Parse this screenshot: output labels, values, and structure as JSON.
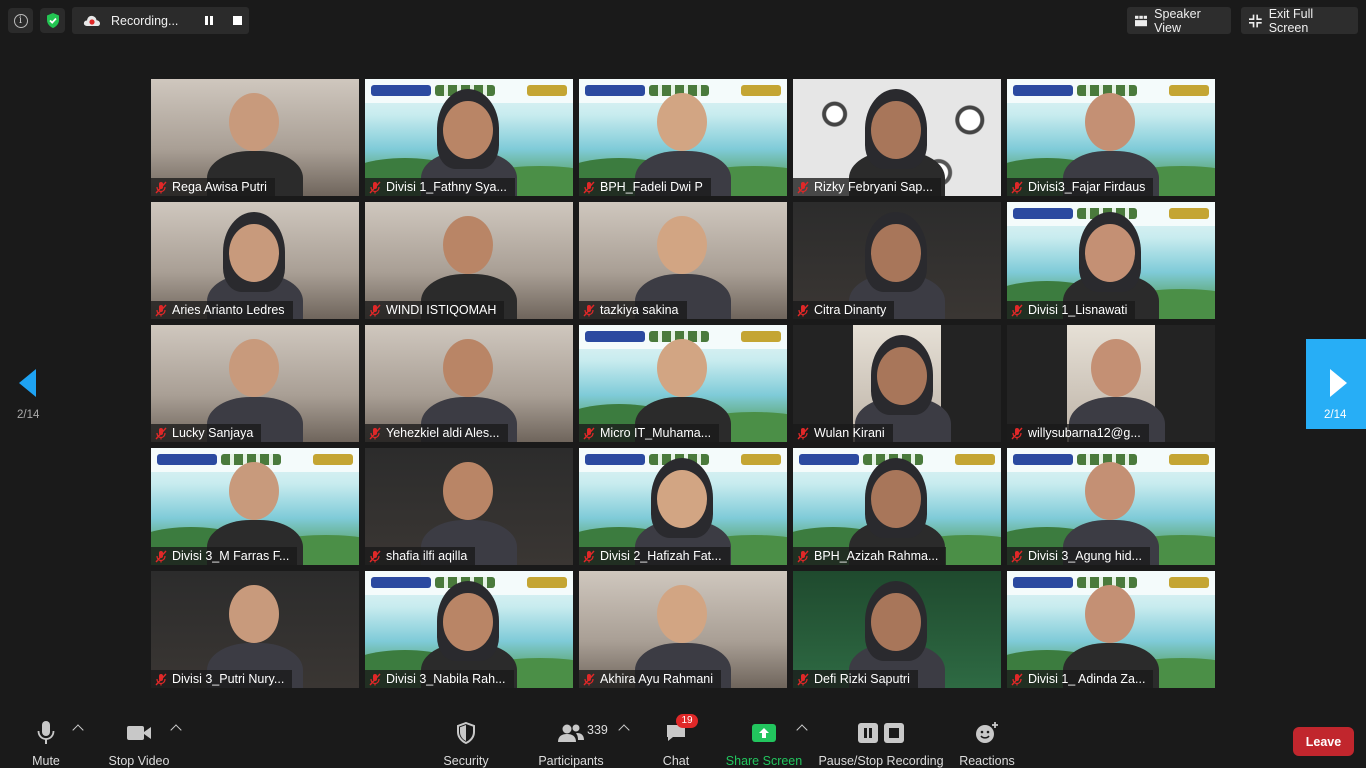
{
  "top_bar": {
    "recording_label": "Recording...",
    "speaker_view_label": "Speaker View",
    "exit_full_screen_label": "Exit Full Screen"
  },
  "pagination": {
    "left_page": "2/14",
    "right_page": "2/14"
  },
  "participants": [
    {
      "name": "Rega Awisa Putri",
      "background": "room"
    },
    {
      "name": "Divisi 1_Fathny Sya...",
      "background": "banner"
    },
    {
      "name": "BPH_Fadeli Dwi P",
      "background": "banner"
    },
    {
      "name": "Rizky Febryani Sap...",
      "background": "circles"
    },
    {
      "name": "Divisi3_Fajar Firdaus",
      "background": "banner"
    },
    {
      "name": "Aries Arianto Ledres",
      "background": "room"
    },
    {
      "name": "WINDI ISTIQOMAH",
      "background": "room"
    },
    {
      "name": "tazkiya sakina",
      "background": "room"
    },
    {
      "name": "Citra Dinanty",
      "background": "dark"
    },
    {
      "name": "Divisi 1_Lisnawati",
      "background": "banner"
    },
    {
      "name": "Lucky Sanjaya",
      "background": "room"
    },
    {
      "name": "Yehezkiel aldi Ales...",
      "background": "room"
    },
    {
      "name": "Micro IT_Muhama...",
      "background": "banner"
    },
    {
      "name": "Wulan Kirani",
      "background": "portrait"
    },
    {
      "name": "willysubarna12@g...",
      "background": "portrait"
    },
    {
      "name": "Divisi 3_M Farras F...",
      "background": "banner"
    },
    {
      "name": "shafia ilfi aqilla",
      "background": "dark"
    },
    {
      "name": "Divisi 2_Hafizah Fat...",
      "background": "banner"
    },
    {
      "name": "BPH_Azizah Rahma...",
      "background": "banner"
    },
    {
      "name": "Divisi 3_Agung hid...",
      "background": "banner"
    },
    {
      "name": "Divisi 3_Putri Nury...",
      "background": "dark"
    },
    {
      "name": "Divisi 3_Nabila Rah...",
      "background": "banner"
    },
    {
      "name": "Akhira Ayu Rahmani",
      "background": "room"
    },
    {
      "name": "Defi Rizki Saputri",
      "background": "green"
    },
    {
      "name": "Divisi 1_ Adinda Za...",
      "background": "banner"
    }
  ],
  "toolbar": {
    "mute": "Mute",
    "stop_video": "Stop Video",
    "security": "Security",
    "participants": "Participants",
    "participants_count": "339",
    "chat": "Chat",
    "chat_badge": "19",
    "share_screen": "Share Screen",
    "pause_stop_recording": "Pause/Stop Recording",
    "reactions": "Reactions",
    "leave": "Leave"
  },
  "colors": {
    "background": "#1a1a1a",
    "share_green": "#22c55e",
    "leave_red": "#c1262d",
    "nav_blue": "#27aef6",
    "mic_off_red": "#e02828"
  }
}
